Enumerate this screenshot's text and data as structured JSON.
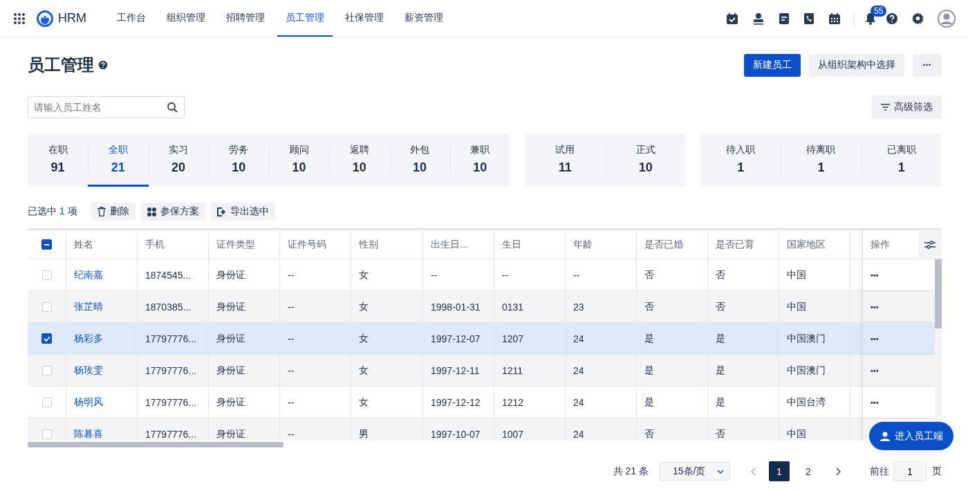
{
  "app": {
    "name": "HRM"
  },
  "nav": [
    {
      "label": "工作台",
      "selected": false
    },
    {
      "label": "组织管理",
      "selected": false
    },
    {
      "label": "招聘管理",
      "selected": false
    },
    {
      "label": "员工管理",
      "selected": true
    },
    {
      "label": "社保管理",
      "selected": false
    },
    {
      "label": "薪资管理",
      "selected": false
    }
  ],
  "notifications": {
    "count": "55"
  },
  "page": {
    "title": "员工管理"
  },
  "actions": [
    {
      "label": "新建员工",
      "kind": "primary"
    },
    {
      "label": "从组织架构中选择",
      "kind": "secondary"
    },
    {
      "label": "•••",
      "kind": "more"
    }
  ],
  "search": {
    "placeholder": "请输入员工姓名"
  },
  "filter_button": "高级筛选",
  "stat_groups": [
    [
      {
        "label": "在职",
        "count": "91",
        "selected": false
      },
      {
        "label": "全职",
        "count": "21",
        "selected": true
      },
      {
        "label": "实习",
        "count": "20",
        "selected": false
      },
      {
        "label": "劳务",
        "count": "10",
        "selected": false
      },
      {
        "label": "顾问",
        "count": "10",
        "selected": false
      },
      {
        "label": "返聘",
        "count": "10",
        "selected": false
      },
      {
        "label": "外包",
        "count": "10",
        "selected": false
      },
      {
        "label": "兼职",
        "count": "10",
        "selected": false
      }
    ],
    [
      {
        "label": "试用",
        "count": "11",
        "selected": false
      },
      {
        "label": "正式",
        "count": "10",
        "selected": false
      }
    ],
    [
      {
        "label": "待入职",
        "count": "1",
        "selected": false
      },
      {
        "label": "待离职",
        "count": "1",
        "selected": false
      },
      {
        "label": "已离职",
        "count": "1",
        "selected": false
      }
    ]
  ],
  "selection": {
    "prefix": "已选中",
    "count": "1",
    "suffix": "项"
  },
  "bulk_actions": [
    {
      "label": "删除",
      "kind": "delete"
    },
    {
      "label": "参保方案",
      "kind": "plan"
    },
    {
      "label": "导出选中",
      "kind": "export"
    }
  ],
  "table": {
    "indeterminate": true,
    "columns": [
      "姓名",
      "手机",
      "证件类型",
      "证件号码",
      "性别",
      "出生日...",
      "生日",
      "年龄",
      "是否已婚",
      "是否已育",
      "国家地区"
    ],
    "action_column": "操作",
    "rows": [
      {
        "selected": false,
        "cells": [
          "纪南嘉",
          "1874545...",
          "身份证",
          "--",
          "女",
          "--",
          "--",
          "--",
          "否",
          "否",
          "中国"
        ],
        "action": "•••"
      },
      {
        "selected": false,
        "cells": [
          "张芷晴",
          "1870385...",
          "身份证",
          "--",
          "女",
          "1998-01-31",
          "0131",
          "23",
          "否",
          "否",
          "中国"
        ],
        "action": "•••"
      },
      {
        "selected": true,
        "cells": [
          "杨彩多",
          "17797776...",
          "身份证",
          "--",
          "女",
          "1997-12-07",
          "1207",
          "24",
          "是",
          "是",
          "中国澳门"
        ],
        "action": "•••"
      },
      {
        "selected": false,
        "cells": [
          "杨玫雯",
          "17797776...",
          "身份证",
          "--",
          "女",
          "1997-12-11",
          "1211",
          "24",
          "是",
          "是",
          "中国澳门"
        ],
        "action": "•••"
      },
      {
        "selected": false,
        "cells": [
          "杨明风",
          "17797776...",
          "身份证",
          "--",
          "女",
          "1997-12-12",
          "1212",
          "24",
          "是",
          "是",
          "中国台湾"
        ],
        "action": "•••"
      },
      {
        "selected": false,
        "cells": [
          "陈暮喜",
          "17797776...",
          "身份证",
          "--",
          "男",
          "1997-10-07",
          "1007",
          "24",
          "否",
          "否",
          "中国"
        ]
      }
    ]
  },
  "pagination": {
    "total": "共 21 条",
    "page_size": "15条/页",
    "pages": [
      {
        "label": "1",
        "selected": true
      },
      {
        "label": "2",
        "selected": false
      }
    ],
    "goto_label": "前往",
    "goto_value": "1",
    "goto_suffix": "页"
  },
  "float_button": "进入员工端"
}
